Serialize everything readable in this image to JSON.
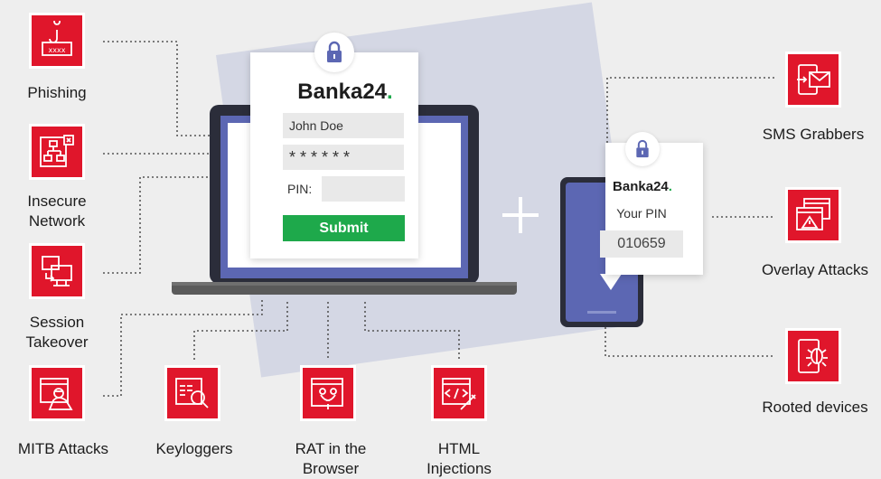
{
  "threats": {
    "phishing": "Phishing",
    "insecure_network": [
      "Insecure",
      "Network"
    ],
    "session_takeover": [
      "Session",
      "Takeover"
    ],
    "mitb_attacks": "MITB Attacks",
    "keyloggers": "Keyloggers",
    "rat_in_browser": [
      "RAT in the",
      "Browser"
    ],
    "html_injections": [
      "HTML",
      "Injections"
    ],
    "sms_grabbers": "SMS Grabbers",
    "overlay_attacks": "Overlay Attacks",
    "rooted_devices": "Rooted devices"
  },
  "login_card": {
    "brand": "Banka24",
    "brand_dot": ".",
    "username": "John Doe",
    "password": "******",
    "pin_label": "PIN:",
    "submit_label": "Submit"
  },
  "phone_card": {
    "brand": "Banka24",
    "brand_dot": ".",
    "prompt": "Your PIN",
    "pin": "010659"
  },
  "colors": {
    "threat_red": "#e0162b",
    "brand_green": "#1ea94b",
    "device_blue": "#5c67b3",
    "device_dark": "#2b2d3a"
  },
  "icons": {
    "phishing": "phishing-hook-icon",
    "insecure_network": "insecure-network-icon",
    "session_takeover": "session-takeover-icon",
    "mitb_attacks": "mitb-attack-icon",
    "keyloggers": "keylogger-icon",
    "rat_in_browser": "rat-in-browser-icon",
    "html_injections": "html-injection-icon",
    "sms_grabbers": "sms-grabber-icon",
    "overlay_attacks": "overlay-attack-icon",
    "rooted_devices": "rooted-device-icon",
    "lock": "lock-icon"
  }
}
